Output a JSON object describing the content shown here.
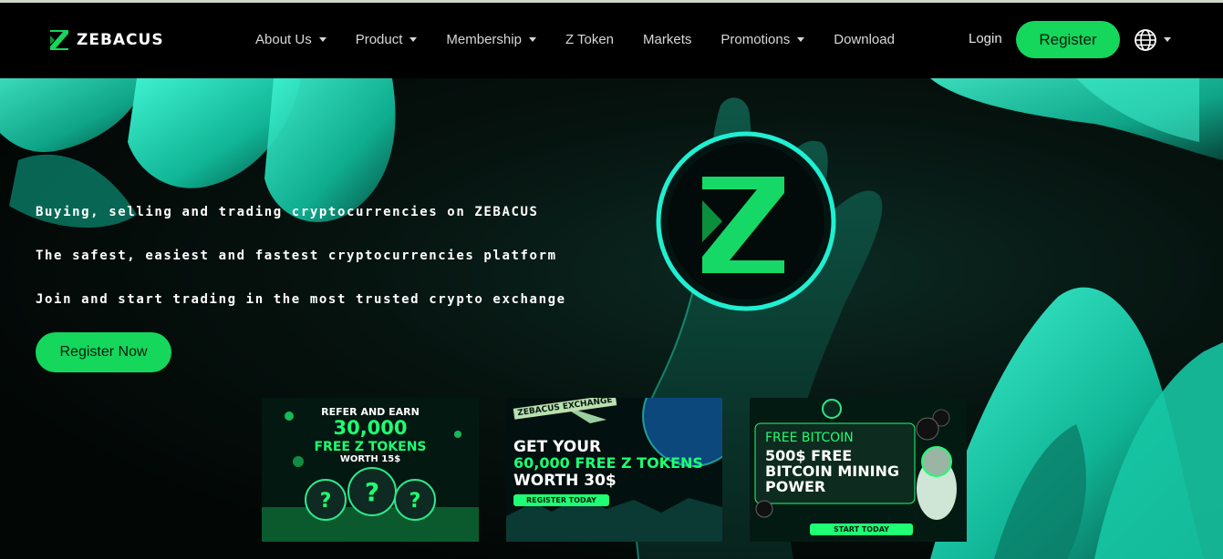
{
  "brand": {
    "name": "ZEBACUS",
    "accent": "#14d75c"
  },
  "nav": {
    "items": [
      {
        "label": "About Us",
        "dropdown": true
      },
      {
        "label": "Product",
        "dropdown": true
      },
      {
        "label": "Membership",
        "dropdown": true
      },
      {
        "label": "Z Token",
        "dropdown": false
      },
      {
        "label": "Markets",
        "dropdown": false
      },
      {
        "label": "Promotions",
        "dropdown": true
      },
      {
        "label": "Download",
        "dropdown": false
      }
    ],
    "login_label": "Login",
    "register_label": "Register",
    "language_icon": "globe-icon"
  },
  "hero": {
    "line1": "Buying, selling and trading cryptocurrencies on ZEBACUS",
    "line2": "The safest, easiest and fastest cryptocurrencies platform",
    "line3": "Join and start trading in the most trusted crypto exchange",
    "cta_label": "Register Now"
  },
  "promos": [
    {
      "line1": "REFER AND EARN",
      "line2": "30,000",
      "line3": "FREE Z TOKENS",
      "line4": "WORTH 15$"
    },
    {
      "badge": "ZEBACUS EXCHANGE",
      "line1": "GET YOUR",
      "line2": "60,000 FREE Z TOKENS",
      "line3": "WORTH 30$",
      "button": "REGISTER TODAY"
    },
    {
      "line1": "FREE BITCOIN",
      "line2": "500$ FREE",
      "line3": "BITCOIN MINING",
      "line4": "POWER",
      "button": "START TODAY"
    }
  ]
}
